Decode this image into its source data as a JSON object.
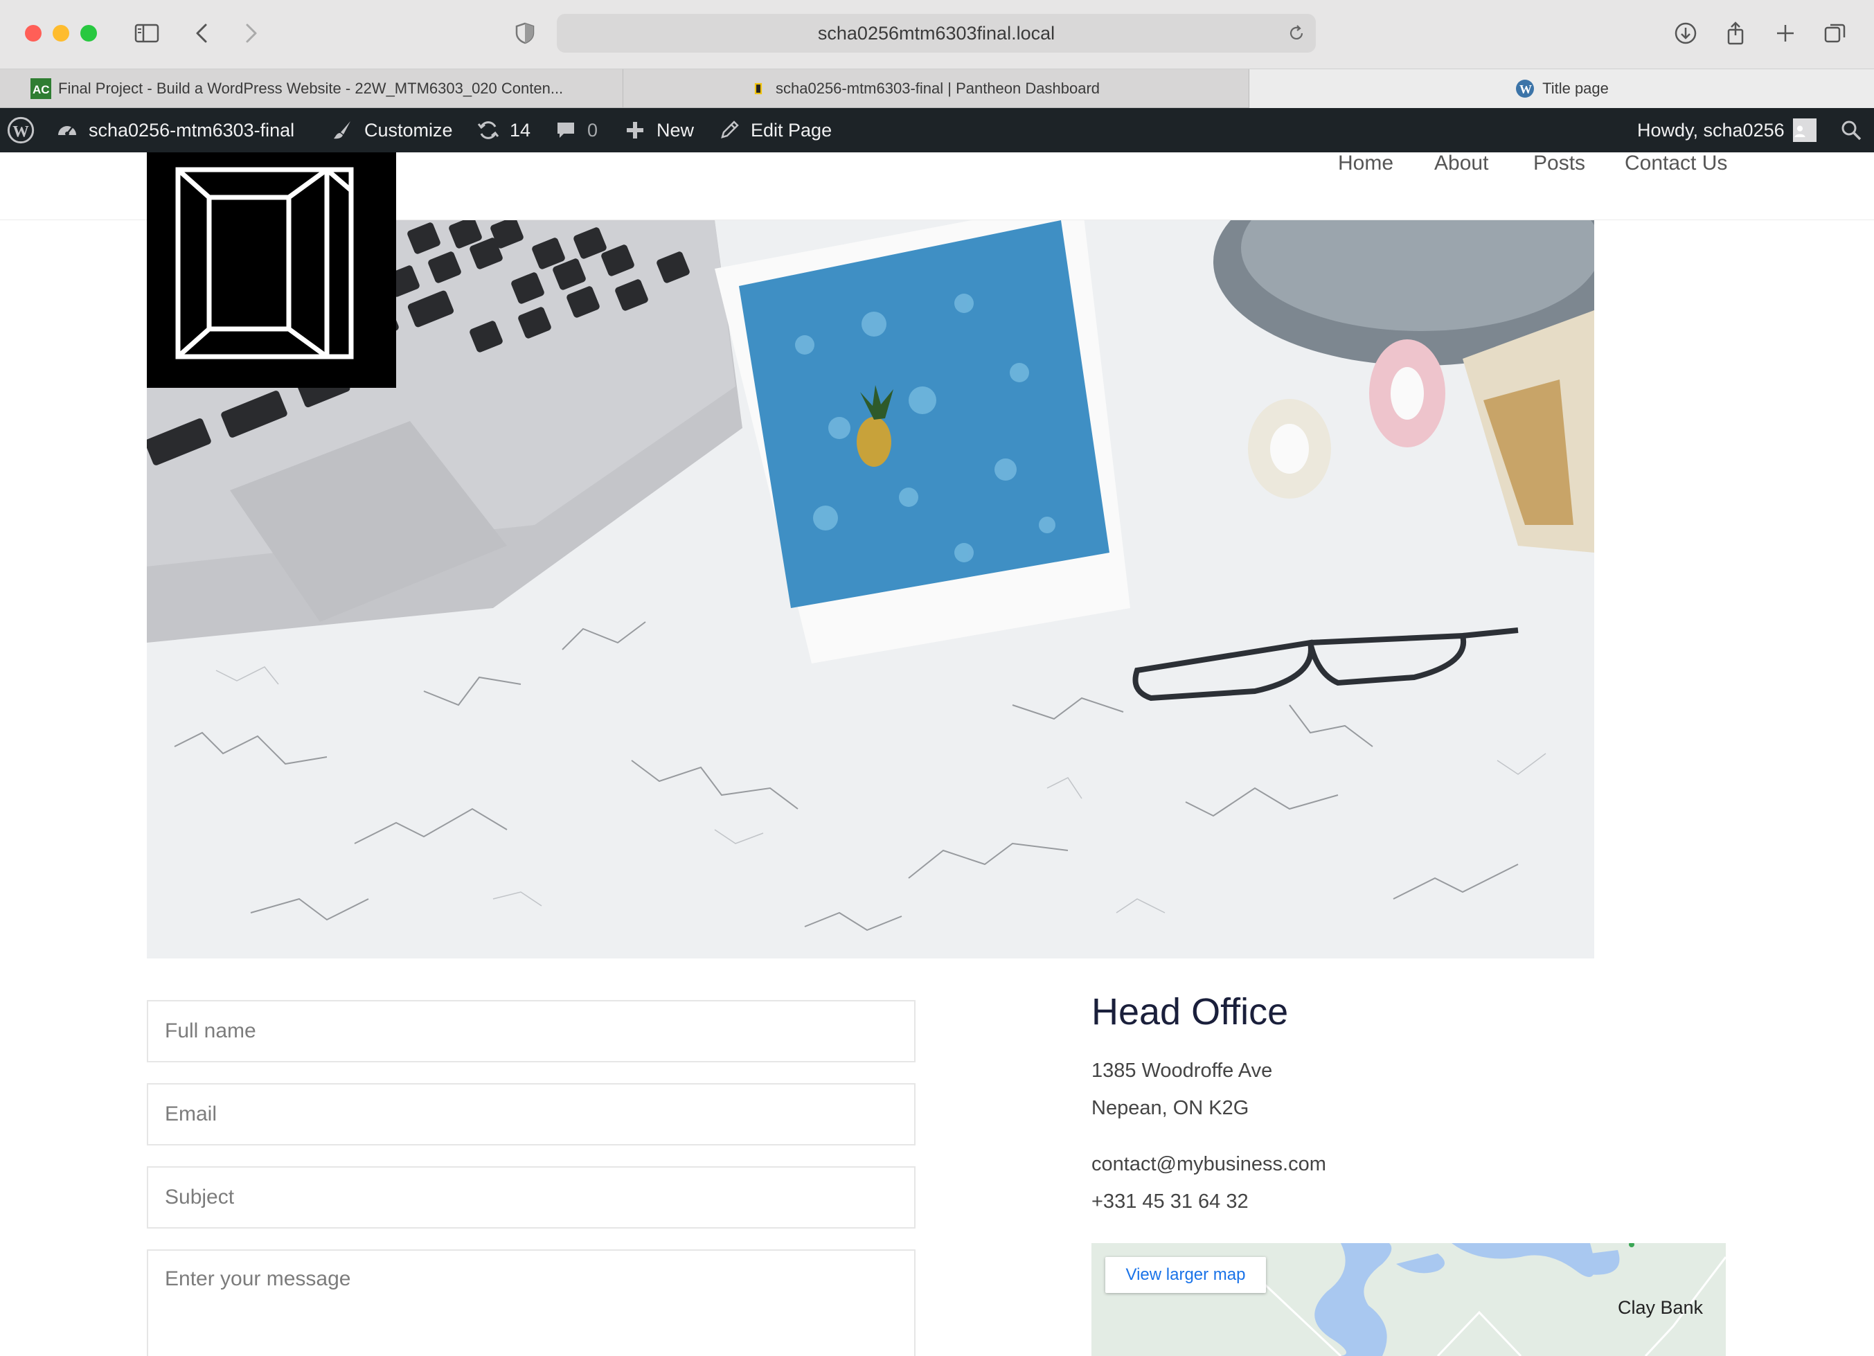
{
  "browser": {
    "url": "scha0256mtm6303final.local",
    "tabs": [
      {
        "label": "Final Project - Build a WordPress Website - 22W_MTM6303_020 Conten..."
      },
      {
        "label": "scha0256-mtm6303-final | Pantheon Dashboard"
      },
      {
        "label": "Title page"
      }
    ]
  },
  "adminbar": {
    "site_name": "scha0256-mtm6303-final",
    "customize": "Customize",
    "updates_count": "14",
    "comments_count": "0",
    "new_label": "New",
    "edit_label": "Edit Page",
    "howdy": "Howdy, scha0256"
  },
  "nav": {
    "items": [
      {
        "label": "Home"
      },
      {
        "label": "About"
      },
      {
        "label": "Posts"
      },
      {
        "label": "Contact Us"
      }
    ]
  },
  "form": {
    "fullname_placeholder": "Full name",
    "email_placeholder": "Email",
    "subject_placeholder": "Subject",
    "message_placeholder": "Enter your message"
  },
  "office": {
    "title": "Head Office",
    "address_line1": "1385 Woodroffe Ave",
    "address_line2": "Nepean, ON K2G",
    "email": "contact@mybusiness.com",
    "phone": "+331 45 31 64 32"
  },
  "map": {
    "button_label": "View larger map",
    "place_label": "Clay Bank"
  },
  "colors": {
    "admin_bar": "#1d2327",
    "heading": "#1a1f3b",
    "link_blue": "#1a73e8"
  }
}
